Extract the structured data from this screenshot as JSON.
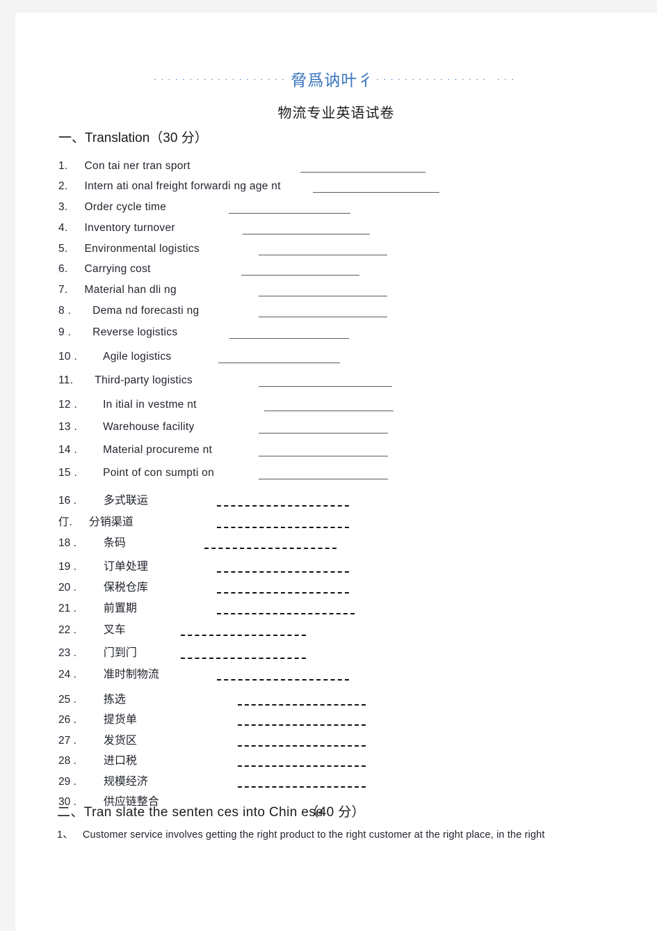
{
  "header": {
    "dots_left": "...................",
    "watermark": "脅爲讷叶彳",
    "dots_right": "................  ...",
    "doc_title": "物流专业英语试卷"
  },
  "sections": [
    {
      "id": "translation",
      "label": "一、Translation（30 分）"
    },
    {
      "id": "sentences",
      "label_before": "二、Tran slate the senten ces into Chin ese",
      "label_after": "（40 分）"
    }
  ],
  "items": [
    {
      "num": "1.",
      "term": "Con tai ner tran sport",
      "lang": "en"
    },
    {
      "num": "2.",
      "term": "Intern ati onal freight forwardi ng age nt",
      "lang": "en"
    },
    {
      "num": "3.",
      "term": "Order cycle time",
      "lang": "en"
    },
    {
      "num": "4.",
      "term": "Inventory turnover",
      "lang": "en"
    },
    {
      "num": "5.",
      "term": "Environmental logistics",
      "lang": "en"
    },
    {
      "num": "6.",
      "term": "Carrying cost",
      "lang": "en"
    },
    {
      "num": "7.",
      "term": "Material han dli ng",
      "lang": "en"
    },
    {
      "num": "8 .",
      "term": "Dema nd forecasti ng",
      "lang": "en"
    },
    {
      "num": "9 .",
      "term": "Reverse logistics",
      "lang": "en"
    },
    {
      "num": "10 .",
      "term": "Agile logistics",
      "lang": "en"
    },
    {
      "num": "11.",
      "term": "Third-party logistics",
      "lang": "en"
    },
    {
      "num": "12 .",
      "term": "In itial in vestme nt",
      "lang": "en"
    },
    {
      "num": "13 .",
      "term": "Warehouse facility",
      "lang": "en"
    },
    {
      "num": "14 .",
      "term": "Material procureme nt",
      "lang": "en"
    },
    {
      "num": "15 .",
      "term": "Point of con sumpti on",
      "lang": "en"
    },
    {
      "num": "16 .",
      "term": "多式联运",
      "lang": "cn"
    },
    {
      "num": "仃.",
      "term": "分销渠道",
      "lang": "cn"
    },
    {
      "num": "18 .",
      "term": "条码",
      "lang": "cn"
    },
    {
      "num": "19 .",
      "term": "订单处理",
      "lang": "cn"
    },
    {
      "num": "20 .",
      "term": "保税仓库",
      "lang": "cn"
    },
    {
      "num": "21 .",
      "term": "前置期",
      "lang": "cn"
    },
    {
      "num": "22 .",
      "term": "叉车",
      "lang": "cn"
    },
    {
      "num": "23 .",
      "term": "门到门",
      "lang": "cn"
    },
    {
      "num": "24 .",
      "term": "准时制物流",
      "lang": "cn"
    },
    {
      "num": "25 .",
      "term": "拣选",
      "lang": "cn"
    },
    {
      "num": "26 .",
      "term": "提货单",
      "lang": "cn"
    },
    {
      "num": "27 .",
      "term": "发货区",
      "lang": "cn"
    },
    {
      "num": "28 .",
      "term": "进口税",
      "lang": "cn"
    },
    {
      "num": "29 .",
      "term": "规模经济",
      "lang": "cn"
    },
    {
      "num": "30 .",
      "term": "供应链整合",
      "lang": "cn"
    }
  ],
  "question": {
    "num": "1、",
    "text": "Customer service involves getting the right product to the right customer at the right place, in the right"
  },
  "colors": {
    "page_background": "#ffffff",
    "canvas_background": "#f4f4f4",
    "text": "#20242c",
    "watermark_blue": "#3a76bd",
    "rule": "#5a5a5a"
  }
}
